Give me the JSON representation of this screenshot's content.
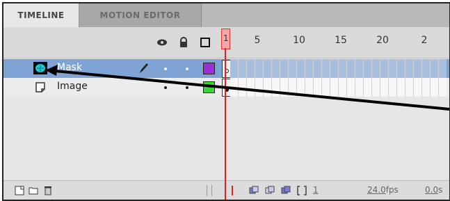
{
  "tabs": [
    {
      "label": "TIMELINE",
      "active": true
    },
    {
      "label": "MOTION EDITOR",
      "active": false
    }
  ],
  "header": {
    "icons": [
      "eye-icon",
      "lock-icon",
      "outline-icon"
    ],
    "frame_numbers": [
      "5",
      "10",
      "15",
      "20",
      "2"
    ]
  },
  "layers": [
    {
      "name": "Mask",
      "type": "mask",
      "selected": true,
      "color": "#9b30d9",
      "edit_icon": "pencil-icon"
    },
    {
      "name": "Image",
      "type": "normal",
      "selected": false,
      "color": "#3ad53a"
    }
  ],
  "footer": {
    "current_frame": "1",
    "fps_value": "24.0",
    "fps_unit": "fps",
    "time_value": "0.0",
    "time_unit": "s"
  },
  "colors": {
    "selected_row": "#7fa3d4",
    "playhead": "#e02020"
  }
}
